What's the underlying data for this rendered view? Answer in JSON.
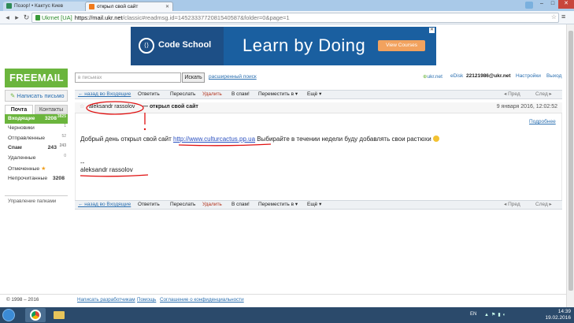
{
  "browser": {
    "tabs": [
      {
        "title": "Позор! • Кактус Киев"
      },
      {
        "title": "открыл свой сайт"
      }
    ],
    "address": {
      "site_label": "Ukrnet [UA]",
      "host": "https://mail.ukr.net",
      "path": "/classic#readmsg.id=1452333772081540587&folder=0&page=1"
    }
  },
  "ad": {
    "brand": "Code School",
    "slogan": "Learn by Doing",
    "cta": "View Courses"
  },
  "logo": "FREEMAIL",
  "compose_label": "Написать письмо",
  "left_tabs": {
    "mail": "Почта",
    "contacts": "Контакты"
  },
  "folders": [
    {
      "name": "Входящие",
      "count": "3208",
      "sup": "3825",
      "active": true
    },
    {
      "name": "Черновики",
      "count": "",
      "sup": "1"
    },
    {
      "name": "Отправленные",
      "count": "",
      "sup": "52"
    },
    {
      "name": "Спам",
      "count": "243",
      "sup": "243"
    },
    {
      "name": "Удаленные",
      "count": "",
      "sup": "0"
    },
    {
      "name": "Отмеченные",
      "count": "",
      "sup": ""
    },
    {
      "name": "Непрочитанные",
      "count": "3208",
      "sup": ""
    }
  ],
  "manage_folders": "Управление папками",
  "search": {
    "placeholder": "в письмах",
    "button": "Искать",
    "advanced": "расширенный поиск"
  },
  "top_links": {
    "ukr": "ukr.net",
    "edisk": "eDisk",
    "user": "22121986@ukr.net",
    "settings": "Настройки",
    "exit": "Выход"
  },
  "toolbar": {
    "back": "← назад во Входящие",
    "reply": "Ответить",
    "forward": "Переслать",
    "delete": "Удалить",
    "spam": "В спам!",
    "move": "Переместить в ▾",
    "more": "Ещё ▾",
    "prev": "◂ Пред",
    "next": "След ▸"
  },
  "message": {
    "sender": "aleksandr rassolov",
    "subject": "— открыл свой сайт",
    "date": "9 января 2016, 12:02:52",
    "more_link": "Подробнее",
    "body_before": "Добрый день открыл свой сайт ",
    "link": "http://www.culturcactus.pp.ua",
    "body_after": " Выбирайте в течении недели буду добавлять свои растюхи",
    "sig_dash": "--",
    "sig_name": "aleksandr rassolov"
  },
  "footer": {
    "copyright": "© 1998 – 2016",
    "developers": "Написать разработчикам",
    "help": "Помощь",
    "privacy": "Соглашение о конфиденциальности"
  },
  "taskbar": {
    "lang": "EN",
    "time": "14:39",
    "date": "19.02.2016"
  }
}
